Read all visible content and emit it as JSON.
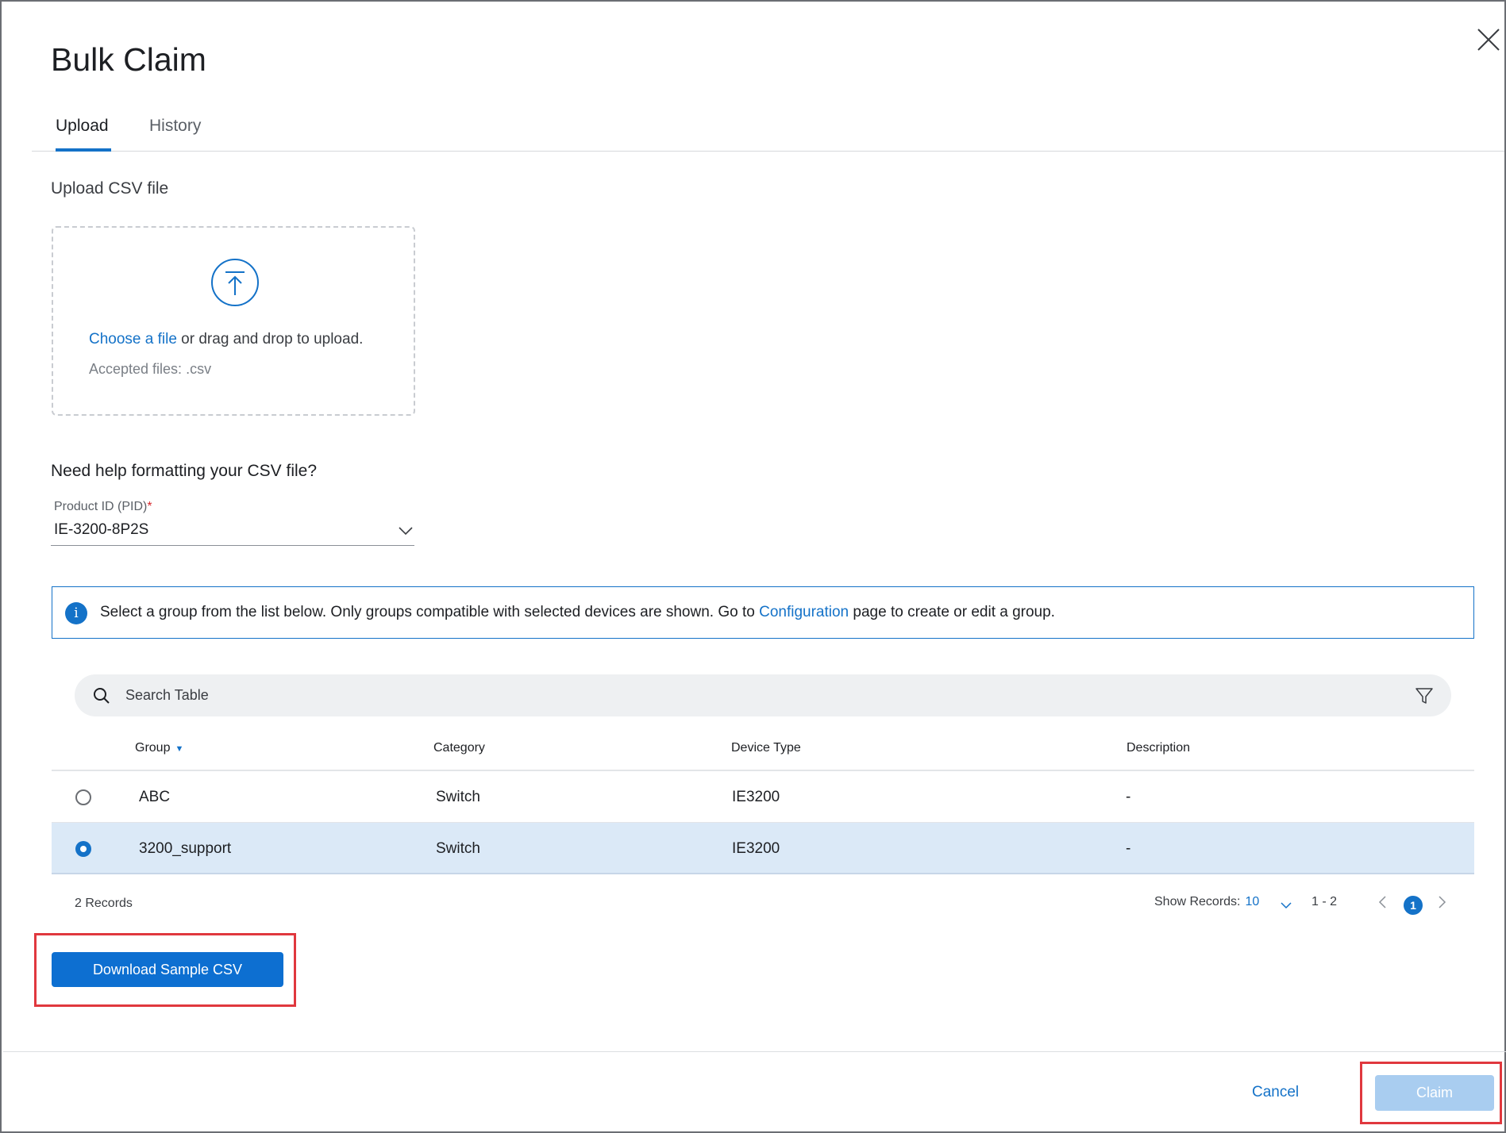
{
  "dialog": {
    "title": "Bulk Claim",
    "close_icon": "close-icon"
  },
  "tabs": [
    {
      "label": "Upload",
      "active": true
    },
    {
      "label": "History",
      "active": false
    }
  ],
  "upload": {
    "section_label": "Upload CSV file",
    "icon": "upload-icon",
    "choose_link": "Choose a file",
    "drop_text": " or drag and drop to upload.",
    "accepted": "Accepted files: .csv"
  },
  "help": {
    "title": "Need help formatting your CSV file?",
    "pid_label": "Product ID (PID)",
    "pid_required_mark": "*",
    "pid_value": "IE-3200-8P2S"
  },
  "info_banner": {
    "icon_glyph": "i",
    "text_before": "Select a group from the list below. Only groups compatible with selected devices are shown. Go to ",
    "link": "Configuration",
    "text_after": " page to create or edit a group."
  },
  "search": {
    "placeholder": "Search Table"
  },
  "table": {
    "headers": {
      "group": "Group",
      "category": "Category",
      "device_type": "Device Type",
      "description": "Description"
    },
    "rows": [
      {
        "group": "ABC",
        "category": "Switch",
        "device_type": "IE3200",
        "description": "-",
        "selected": false
      },
      {
        "group": "3200_support",
        "category": "Switch",
        "device_type": "IE3200",
        "description": "-",
        "selected": true
      }
    ]
  },
  "pagination": {
    "records": "2 Records",
    "show_records_label": "Show Records:",
    "show_records_value": "10",
    "range": "1 - 2",
    "current_page": "1"
  },
  "buttons": {
    "download_sample": "Download Sample CSV",
    "cancel": "Cancel",
    "claim": "Claim"
  },
  "colors": {
    "accent": "#1472c8",
    "highlight_box": "#e0383e",
    "claim_disabled": "#a9cdf0",
    "selected_row": "#dbe9f7"
  }
}
